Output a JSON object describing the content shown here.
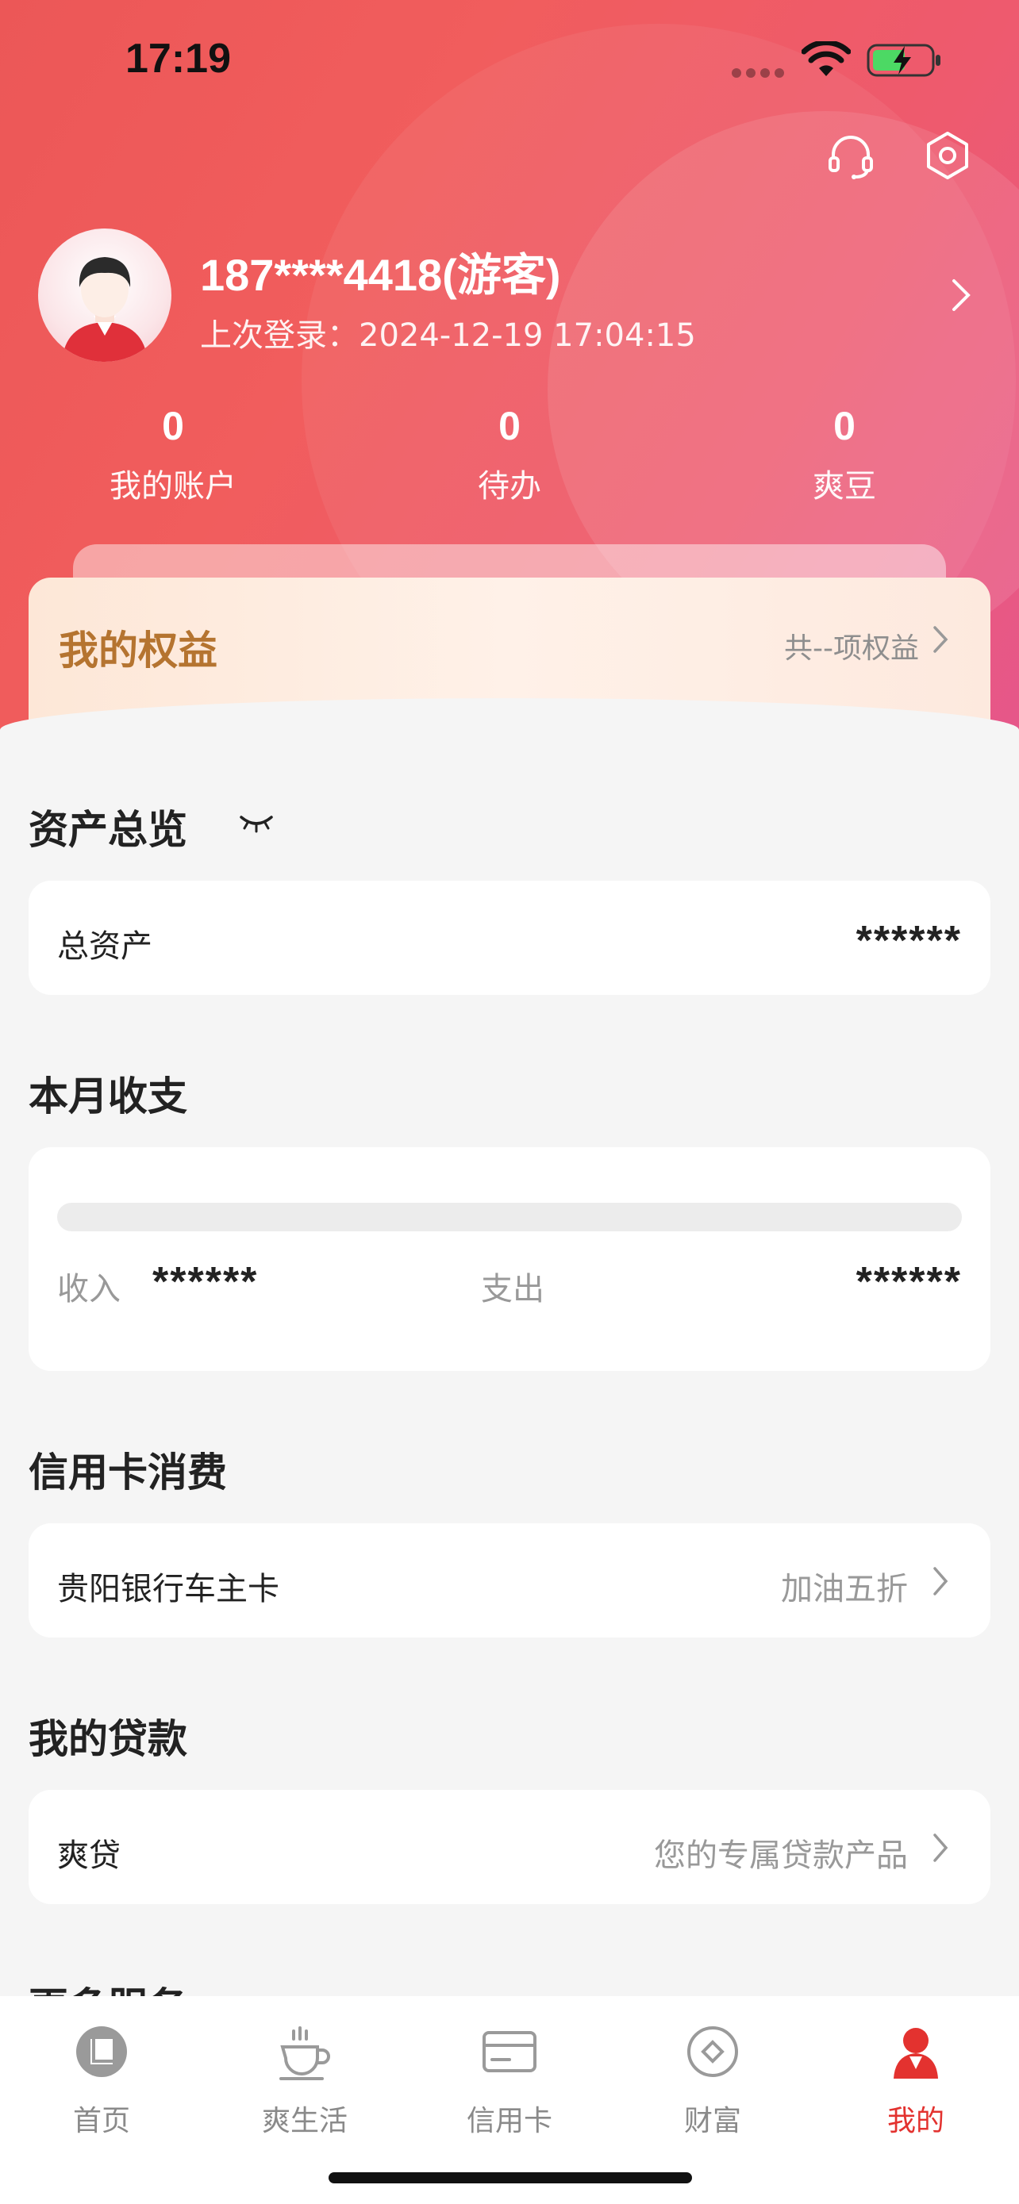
{
  "status_bar": {
    "time": "17:19"
  },
  "profile": {
    "phone": "187****4418(游客)",
    "last_login": "上次登录：2024-12-19 17:04:15"
  },
  "stats": [
    {
      "value": "0",
      "label": "我的账户"
    },
    {
      "value": "0",
      "label": "待办"
    },
    {
      "value": "0",
      "label": "爽豆"
    }
  ],
  "benefits": {
    "title": "我的权益",
    "summary": "共--项权益"
  },
  "asset_overview": {
    "title": "资产总览",
    "total_label": "总资产",
    "total_value": "******"
  },
  "monthly": {
    "title": "本月收支",
    "income_label": "收入",
    "income_value": "******",
    "expense_label": "支出",
    "expense_value": "******"
  },
  "credit_card": {
    "title": "信用卡消费",
    "card_name": "贵阳银行车主卡",
    "promo": "加油五折"
  },
  "loans": {
    "title": "我的贷款",
    "product": "爽贷",
    "hint": "您的专属贷款产品"
  },
  "more_services": {
    "title": "更多服务"
  },
  "tabbar": [
    {
      "label": "首页",
      "icon": "home-icon"
    },
    {
      "label": "爽生活",
      "icon": "coffee-cup-icon"
    },
    {
      "label": "信用卡",
      "icon": "credit-card-icon"
    },
    {
      "label": "财富",
      "icon": "wealth-icon"
    },
    {
      "label": "我的",
      "icon": "profile-icon",
      "active": true
    }
  ],
  "colors": {
    "brand_red": "#e3322f",
    "benefit_gold": "#b57430",
    "hero_start": "#ec5757",
    "hero_end": "#e6578a"
  }
}
